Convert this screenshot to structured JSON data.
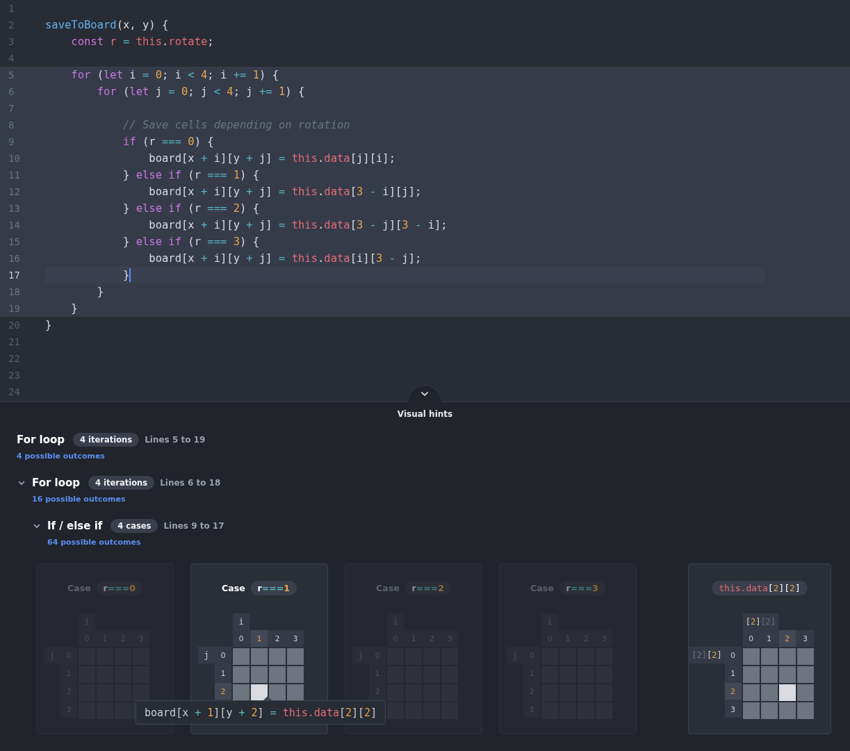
{
  "editor": {
    "lines": [
      {
        "number": "1",
        "highlighted": false,
        "current": false
      },
      {
        "number": "2",
        "highlighted": false,
        "current": false,
        "tokens": [
          {
            "text": "saveToBoard",
            "kind": "fn"
          },
          {
            "text": "(x, y) {",
            "kind": "plain"
          }
        ]
      },
      {
        "number": "3",
        "highlighted": false,
        "current": false,
        "tokens": [
          {
            "text": "    const",
            "kind": "kw"
          },
          {
            "text": " r",
            "kind": "var"
          },
          {
            "text": " = ",
            "kind": "op"
          },
          {
            "text": "this",
            "kind": "var"
          },
          {
            "text": ".",
            "kind": "plain"
          },
          {
            "text": "rotate",
            "kind": "var"
          },
          {
            "text": ";",
            "kind": "plain"
          }
        ]
      },
      {
        "number": "4",
        "highlighted": false,
        "current": false
      },
      {
        "number": "5",
        "highlighted": true,
        "current": false,
        "tokens": [
          {
            "text": "    for",
            "kind": "kw"
          },
          {
            "text": " (",
            "kind": "plain"
          },
          {
            "text": "let",
            "kind": "kw"
          },
          {
            "text": " i ",
            "kind": "plain"
          },
          {
            "text": "= ",
            "kind": "op"
          },
          {
            "text": "0",
            "kind": "num"
          },
          {
            "text": "; i ",
            "kind": "plain"
          },
          {
            "text": "< ",
            "kind": "op"
          },
          {
            "text": "4",
            "kind": "num"
          },
          {
            "text": "; i ",
            "kind": "plain"
          },
          {
            "text": "+= ",
            "kind": "op"
          },
          {
            "text": "1",
            "kind": "num"
          },
          {
            "text": ") {",
            "kind": "plain"
          }
        ]
      },
      {
        "number": "6",
        "highlighted": true,
        "current": false,
        "tokens": [
          {
            "text": "        for",
            "kind": "kw"
          },
          {
            "text": " (",
            "kind": "plain"
          },
          {
            "text": "let",
            "kind": "kw"
          },
          {
            "text": " j ",
            "kind": "plain"
          },
          {
            "text": "= ",
            "kind": "op"
          },
          {
            "text": "0",
            "kind": "num"
          },
          {
            "text": "; j ",
            "kind": "plain"
          },
          {
            "text": "< ",
            "kind": "op"
          },
          {
            "text": "4",
            "kind": "num"
          },
          {
            "text": "; j ",
            "kind": "plain"
          },
          {
            "text": "+= ",
            "kind": "op"
          },
          {
            "text": "1",
            "kind": "num"
          },
          {
            "text": ") {",
            "kind": "plain"
          }
        ]
      },
      {
        "number": "7",
        "highlighted": true,
        "current": false
      },
      {
        "number": "8",
        "highlighted": true,
        "current": false,
        "tokens": [
          {
            "text": "            // Save cells depending on rotation",
            "kind": "comment"
          }
        ]
      },
      {
        "number": "9",
        "highlighted": true,
        "current": false,
        "tokens": [
          {
            "text": "            if",
            "kind": "kw"
          },
          {
            "text": " (r ",
            "kind": "plain"
          },
          {
            "text": "=== ",
            "kind": "op"
          },
          {
            "text": "0",
            "kind": "num"
          },
          {
            "text": ") {",
            "kind": "plain"
          }
        ]
      },
      {
        "number": "10",
        "highlighted": true,
        "current": false,
        "tokens": [
          {
            "text": "                board[x ",
            "kind": "plain"
          },
          {
            "text": "+",
            "kind": "op"
          },
          {
            "text": " i][y ",
            "kind": "plain"
          },
          {
            "text": "+",
            "kind": "op"
          },
          {
            "text": " j] ",
            "kind": "plain"
          },
          {
            "text": "= ",
            "kind": "op"
          },
          {
            "text": "this",
            "kind": "var"
          },
          {
            "text": ".",
            "kind": "plain"
          },
          {
            "text": "data",
            "kind": "var"
          },
          {
            "text": "[j][i];",
            "kind": "plain"
          }
        ]
      },
      {
        "number": "11",
        "highlighted": true,
        "current": false,
        "tokens": [
          {
            "text": "            } ",
            "kind": "plain"
          },
          {
            "text": "else if",
            "kind": "kw"
          },
          {
            "text": " (r ",
            "kind": "plain"
          },
          {
            "text": "=== ",
            "kind": "op"
          },
          {
            "text": "1",
            "kind": "num"
          },
          {
            "text": ") {",
            "kind": "plain"
          }
        ]
      },
      {
        "number": "12",
        "highlighted": true,
        "current": false,
        "tokens": [
          {
            "text": "                board[x ",
            "kind": "plain"
          },
          {
            "text": "+",
            "kind": "op"
          },
          {
            "text": " i][y ",
            "kind": "plain"
          },
          {
            "text": "+",
            "kind": "op"
          },
          {
            "text": " j] ",
            "kind": "plain"
          },
          {
            "text": "= ",
            "kind": "op"
          },
          {
            "text": "this",
            "kind": "var"
          },
          {
            "text": ".",
            "kind": "plain"
          },
          {
            "text": "data",
            "kind": "var"
          },
          {
            "text": "[",
            "kind": "plain"
          },
          {
            "text": "3 ",
            "kind": "num"
          },
          {
            "text": "-",
            "kind": "op"
          },
          {
            "text": " i][j];",
            "kind": "plain"
          }
        ]
      },
      {
        "number": "13",
        "highlighted": true,
        "current": false,
        "tokens": [
          {
            "text": "            } ",
            "kind": "plain"
          },
          {
            "text": "else if",
            "kind": "kw"
          },
          {
            "text": " (r ",
            "kind": "plain"
          },
          {
            "text": "=== ",
            "kind": "op"
          },
          {
            "text": "2",
            "kind": "num"
          },
          {
            "text": ") {",
            "kind": "plain"
          }
        ]
      },
      {
        "number": "14",
        "highlighted": true,
        "current": false,
        "tokens": [
          {
            "text": "                board[x ",
            "kind": "plain"
          },
          {
            "text": "+",
            "kind": "op"
          },
          {
            "text": " i][y ",
            "kind": "plain"
          },
          {
            "text": "+",
            "kind": "op"
          },
          {
            "text": " j] ",
            "kind": "plain"
          },
          {
            "text": "= ",
            "kind": "op"
          },
          {
            "text": "this",
            "kind": "var"
          },
          {
            "text": ".",
            "kind": "plain"
          },
          {
            "text": "data",
            "kind": "var"
          },
          {
            "text": "[",
            "kind": "plain"
          },
          {
            "text": "3 ",
            "kind": "num"
          },
          {
            "text": "-",
            "kind": "op"
          },
          {
            "text": " j][",
            "kind": "plain"
          },
          {
            "text": "3 ",
            "kind": "num"
          },
          {
            "text": "-",
            "kind": "op"
          },
          {
            "text": " i];",
            "kind": "plain"
          }
        ]
      },
      {
        "number": "15",
        "highlighted": true,
        "current": false,
        "tokens": [
          {
            "text": "            } ",
            "kind": "plain"
          },
          {
            "text": "else if",
            "kind": "kw"
          },
          {
            "text": " (r ",
            "kind": "plain"
          },
          {
            "text": "=== ",
            "kind": "op"
          },
          {
            "text": "3",
            "kind": "num"
          },
          {
            "text": ") {",
            "kind": "plain"
          }
        ]
      },
      {
        "number": "16",
        "highlighted": true,
        "current": false,
        "tokens": [
          {
            "text": "                board[x ",
            "kind": "plain"
          },
          {
            "text": "+",
            "kind": "op"
          },
          {
            "text": " i][y ",
            "kind": "plain"
          },
          {
            "text": "+",
            "kind": "op"
          },
          {
            "text": " j] ",
            "kind": "plain"
          },
          {
            "text": "= ",
            "kind": "op"
          },
          {
            "text": "this",
            "kind": "var"
          },
          {
            "text": ".",
            "kind": "plain"
          },
          {
            "text": "data",
            "kind": "var"
          },
          {
            "text": "[i][",
            "kind": "plain"
          },
          {
            "text": "3 ",
            "kind": "num"
          },
          {
            "text": "-",
            "kind": "op"
          },
          {
            "text": " j];",
            "kind": "plain"
          }
        ]
      },
      {
        "number": "17",
        "highlighted": true,
        "current": true,
        "tokens": [
          {
            "text": "            }",
            "kind": "plain"
          }
        ]
      },
      {
        "number": "18",
        "highlighted": true,
        "current": false,
        "tokens": [
          {
            "text": "        }",
            "kind": "plain"
          }
        ]
      },
      {
        "number": "19",
        "highlighted": true,
        "current": false,
        "tokens": [
          {
            "text": "    }",
            "kind": "plain"
          }
        ]
      },
      {
        "number": "20",
        "highlighted": false,
        "current": false,
        "tokens": [
          {
            "text": "}",
            "kind": "plain"
          }
        ]
      },
      {
        "number": "21",
        "highlighted": false,
        "current": false
      },
      {
        "number": "22",
        "highlighted": false,
        "current": false
      },
      {
        "number": "23",
        "highlighted": false,
        "current": false
      },
      {
        "number": "24",
        "highlighted": false,
        "current": false
      }
    ]
  },
  "panel": {
    "title": "Visual hints",
    "hints": [
      {
        "title": "For loop",
        "badge": "4 iterations",
        "range": "Lines 5 to 19",
        "outcomes": "4 possible outcomes",
        "children": [
          {
            "title": "For loop",
            "badge": "4 iterations",
            "range": "Lines 6 to 18",
            "outcomes": "16 possible outcomes",
            "expanded": true,
            "children": [
              {
                "title": "If / else if",
                "badge": "4 cases",
                "range": "Lines 9 to 17",
                "outcomes": "64 possible outcomes",
                "expanded": true
              }
            ]
          }
        ]
      }
    ],
    "cards": [
      {
        "kind": "case",
        "selected": false,
        "label": "Case",
        "pill": [
          {
            "text": "r",
            "kind": "plain"
          },
          {
            "text": "===",
            "kind": "op"
          },
          {
            "text": "0",
            "kind": "num"
          }
        ],
        "x_axis": [
          {
            "text": "i",
            "kind": "plain"
          }
        ],
        "y_axis": [
          {
            "text": "j",
            "kind": "plain"
          }
        ],
        "columns": [
          {
            "label": "0",
            "selected": false
          },
          {
            "label": "1",
            "selected": false
          },
          {
            "label": "2",
            "selected": false
          },
          {
            "label": "3",
            "selected": false
          }
        ],
        "rows": [
          {
            "label": "0",
            "selected": false
          },
          {
            "label": "1",
            "selected": false
          },
          {
            "label": "2",
            "selected": false
          },
          {
            "label": "3",
            "selected": false
          }
        ]
      },
      {
        "kind": "case",
        "selected": true,
        "label": "Case",
        "pill": [
          {
            "text": "r",
            "kind": "plain"
          },
          {
            "text": "===",
            "kind": "op"
          },
          {
            "text": "1",
            "kind": "num"
          }
        ],
        "x_axis": [
          {
            "text": "i",
            "kind": "plain"
          }
        ],
        "y_axis": [
          {
            "text": "j",
            "kind": "plain"
          }
        ],
        "columns": [
          {
            "label": "0",
            "selected": false
          },
          {
            "label": "1",
            "selected": true
          },
          {
            "label": "2",
            "selected": false
          },
          {
            "label": "3",
            "selected": false
          }
        ],
        "rows": [
          {
            "label": "0",
            "selected": false
          },
          {
            "label": "1",
            "selected": false
          },
          {
            "label": "2",
            "selected": true
          }
        ]
      },
      {
        "kind": "case",
        "selected": false,
        "label": "Case",
        "pill": [
          {
            "text": "r",
            "kind": "plain"
          },
          {
            "text": "===",
            "kind": "op"
          },
          {
            "text": "2",
            "kind": "num"
          }
        ],
        "x_axis": [
          {
            "text": "i",
            "kind": "plain"
          }
        ],
        "y_axis": [
          {
            "text": "j",
            "kind": "plain"
          }
        ],
        "columns": [
          {
            "label": "0",
            "selected": false
          },
          {
            "label": "1",
            "selected": false
          },
          {
            "label": "2",
            "selected": false
          },
          {
            "label": "3",
            "selected": false
          }
        ],
        "rows": [
          {
            "label": "0",
            "selected": false
          },
          {
            "label": "1",
            "selected": false
          },
          {
            "label": "2",
            "selected": false
          },
          {
            "selected": false
          }
        ]
      },
      {
        "kind": "case",
        "selected": false,
        "label": "Case",
        "pill": [
          {
            "text": "r",
            "kind": "plain"
          },
          {
            "text": "===",
            "kind": "op"
          },
          {
            "text": "3",
            "kind": "num"
          }
        ],
        "x_axis": [
          {
            "text": "i",
            "kind": "plain"
          }
        ],
        "y_axis": [
          {
            "text": "j",
            "kind": "plain"
          }
        ],
        "columns": [
          {
            "label": "0",
            "selected": false
          },
          {
            "label": "1",
            "selected": false
          },
          {
            "label": "2",
            "selected": false
          },
          {
            "label": "3",
            "selected": false
          }
        ],
        "rows": [
          {
            "label": "0",
            "selected": false
          },
          {
            "label": "1",
            "selected": false
          },
          {
            "label": "2",
            "selected": false
          },
          {
            "label": "3",
            "selected": false
          }
        ]
      },
      {
        "kind": "result",
        "selected": true,
        "pill": [
          {
            "text": "this.data",
            "kind": "var"
          },
          {
            "text": "[",
            "kind": "plain"
          },
          {
            "text": "2",
            "kind": "num"
          },
          {
            "text": "][",
            "kind": "plain"
          },
          {
            "text": "2",
            "kind": "num"
          },
          {
            "text": "]",
            "kind": "plain"
          }
        ],
        "x_axis": [
          {
            "text": "[",
            "kind": "plain"
          },
          {
            "text": "2",
            "kind": "num"
          },
          {
            "text": "]",
            "kind": "plain"
          },
          {
            "text": "[2]",
            "kind": "faded"
          }
        ],
        "y_axis": [
          {
            "text": "[2]",
            "kind": "faded"
          },
          {
            "text": "[",
            "kind": "plain"
          },
          {
            "text": "2",
            "kind": "num"
          },
          {
            "text": "]",
            "kind": "plain"
          }
        ],
        "columns": [
          {
            "label": "0",
            "selected": false
          },
          {
            "label": "1",
            "selected": false
          },
          {
            "label": "2",
            "selected": true
          },
          {
            "label": "3",
            "selected": false
          }
        ],
        "rows": [
          {
            "label": "0",
            "selected": false
          },
          {
            "label": "1",
            "selected": false
          },
          {
            "label": "2",
            "selected": true
          },
          {
            "label": "3",
            "selected": false
          }
        ]
      }
    ],
    "tooltip": [
      {
        "text": "board[x ",
        "kind": "plain"
      },
      {
        "text": "+ ",
        "kind": "op"
      },
      {
        "text": "1",
        "kind": "num"
      },
      {
        "text": "][y ",
        "kind": "plain"
      },
      {
        "text": "+ ",
        "kind": "op"
      },
      {
        "text": "2",
        "kind": "num"
      },
      {
        "text": "] ",
        "kind": "plain"
      },
      {
        "text": "= ",
        "kind": "op"
      },
      {
        "text": "this.data",
        "kind": "var"
      },
      {
        "text": "[",
        "kind": "plain"
      },
      {
        "text": "2",
        "kind": "num"
      },
      {
        "text": "][",
        "kind": "plain"
      },
      {
        "text": "2",
        "kind": "num"
      },
      {
        "text": "]",
        "kind": "plain"
      }
    ]
  }
}
